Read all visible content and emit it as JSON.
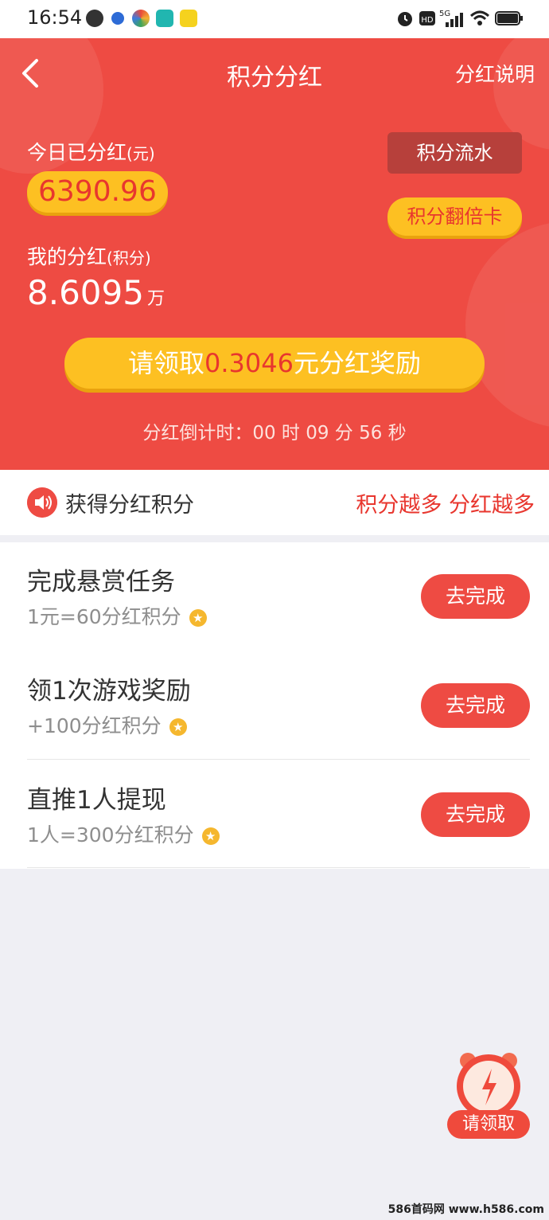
{
  "status_bar": {
    "time": "16:54"
  },
  "nav": {
    "title": "积分分红",
    "right_link": "分红说明"
  },
  "summary": {
    "today_label": "今日已分红",
    "today_unit": "(元)",
    "today_amount": "6390.96",
    "my_label": "我的分红",
    "my_unit": "(积分)",
    "my_value": "8.6095",
    "my_value_unit": "万",
    "flow_button": "积分流水",
    "double_card_button": "积分翻倍卡"
  },
  "claim": {
    "prefix": "请领取",
    "amount": "0.3046",
    "suffix": "元分红奖励"
  },
  "countdown": {
    "text": "分红倒计时：00 时 09 分 56 秒"
  },
  "info": {
    "label": "获得分红积分",
    "slogan": "积分越多 分红越多"
  },
  "tasks": [
    {
      "title": "完成悬赏任务",
      "subtitle": "1元=60分红积分",
      "button": "去完成"
    },
    {
      "title": "领1次游戏奖励",
      "subtitle": "+100分红积分",
      "button": "去完成"
    },
    {
      "title": "直推1人提现",
      "subtitle": "1人=300分红积分",
      "button": "去完成"
    }
  ],
  "floating": {
    "label": "请领取"
  },
  "watermark": "586首码网 www.h586.com",
  "colors": {
    "primary_red": "#ee4b43",
    "gold": "#fdc022",
    "text_red": "#e8362e"
  }
}
